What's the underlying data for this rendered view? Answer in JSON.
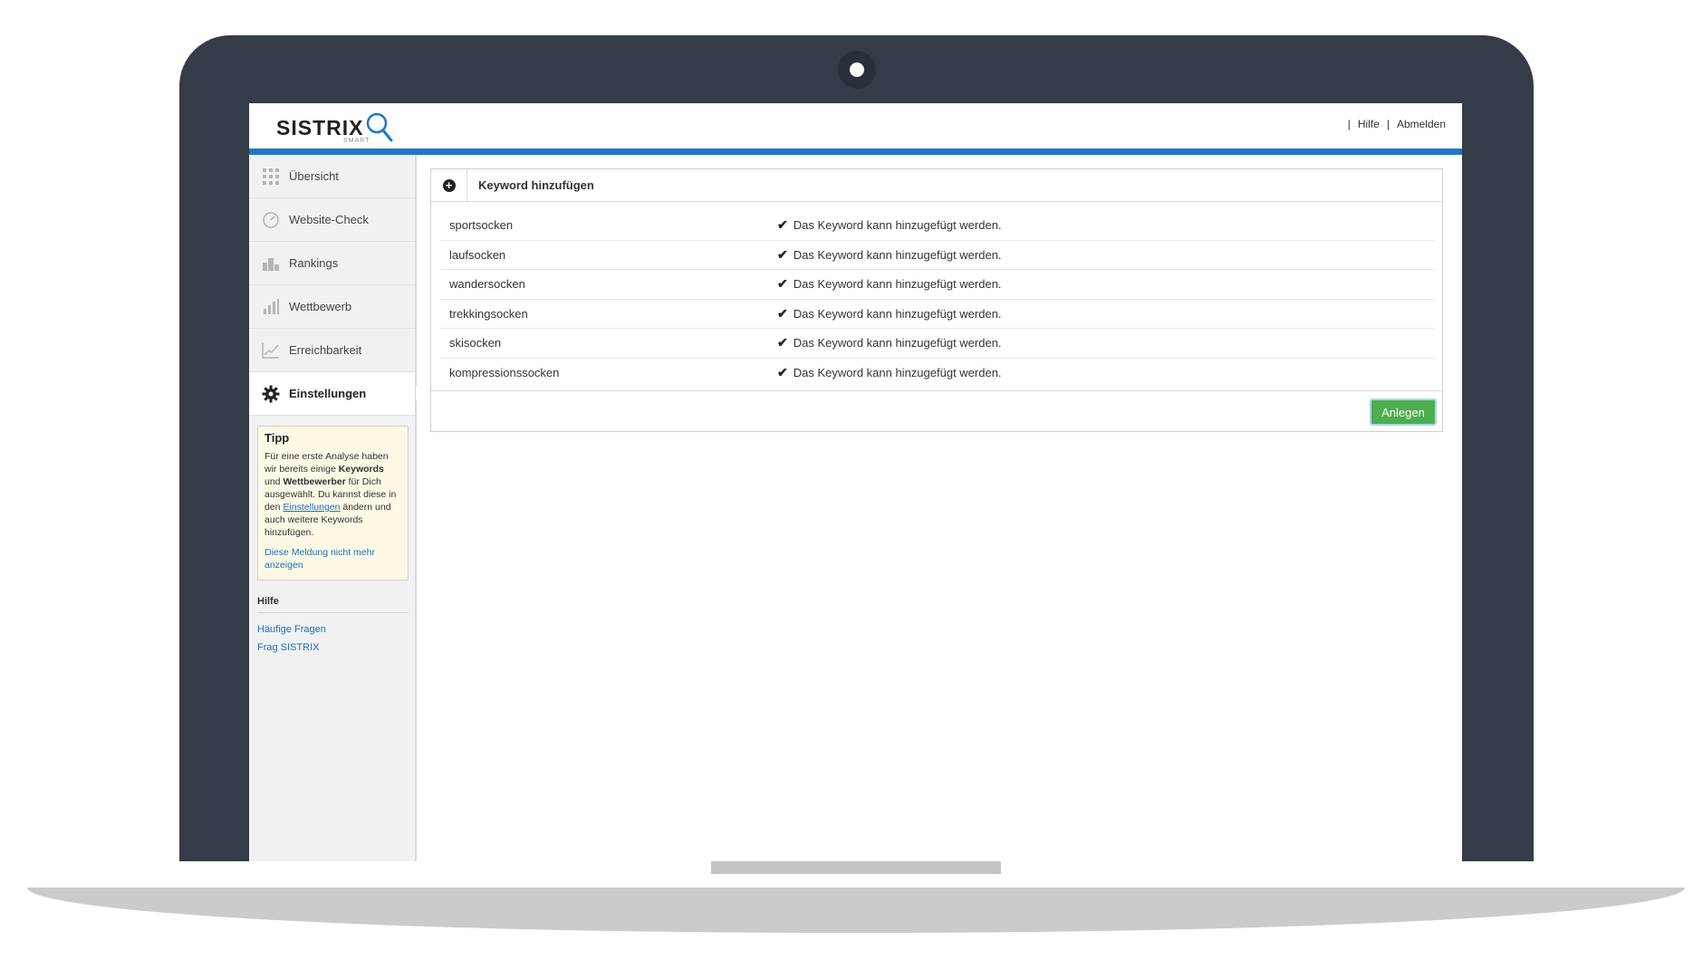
{
  "header": {
    "logo_text": "SISTRIX",
    "logo_sub": "SMART",
    "links": [
      "Hilfe",
      "Abmelden"
    ]
  },
  "sidebar": {
    "items": [
      {
        "label": "Übersicht",
        "icon": "grid-icon"
      },
      {
        "label": "Website-Check",
        "icon": "gauge-icon"
      },
      {
        "label": "Rankings",
        "icon": "podium-icon"
      },
      {
        "label": "Wettbewerb",
        "icon": "bar-chart-icon"
      },
      {
        "label": "Erreichbarkeit",
        "icon": "line-chart-icon"
      },
      {
        "label": "Einstellungen",
        "icon": "gear-icon",
        "active": true
      }
    ],
    "tipp": {
      "title": "Tipp",
      "text_1": "Für eine erste Analyse haben wir bereits einige ",
      "bold_1": "Keywords",
      "text_2": " und ",
      "bold_2": "Wettbewerber",
      "text_3": " für Dich ausgewählt. Du kannst diese in den ",
      "link": "Einstellungen",
      "text_4": " ändern und auch weitere Keywords hinzufügen.",
      "dismiss": "Diese Meldung nicht mehr anzeigen"
    },
    "hilfe": {
      "title": "Hilfe",
      "links": [
        "Häufige Fragen",
        "Frag SISTRIX"
      ]
    }
  },
  "panel": {
    "title": "Keyword hinzufügen",
    "rows": [
      {
        "keyword": "sportsocken",
        "status": "Das Keyword kann hinzugefügt werden."
      },
      {
        "keyword": "laufsocken",
        "status": "Das Keyword kann hinzugefügt werden."
      },
      {
        "keyword": "wandersocken",
        "status": "Das Keyword kann hinzugefügt werden."
      },
      {
        "keyword": "trekkingsocken",
        "status": "Das Keyword kann hinzugefügt werden."
      },
      {
        "keyword": "skisocken",
        "status": "Das Keyword kann hinzugefügt werden."
      },
      {
        "keyword": "kompressionssocken",
        "status": "Das Keyword kann hinzugefügt werden."
      }
    ],
    "button_label": "Anlegen"
  },
  "colors": {
    "accent_blue": "#1d78c6",
    "button_green": "#4cae4c",
    "bezel": "#353c47"
  }
}
